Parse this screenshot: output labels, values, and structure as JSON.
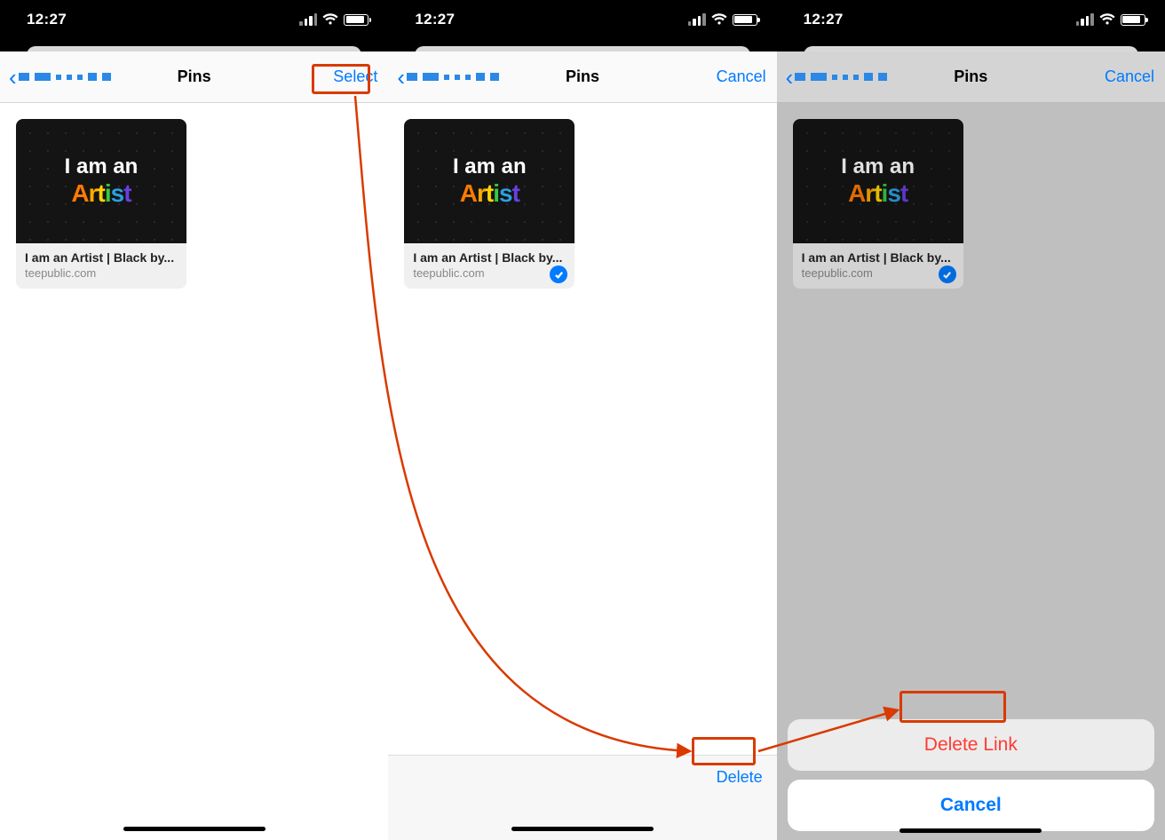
{
  "status": {
    "time": "12:27"
  },
  "nav": {
    "title": "Pins",
    "select": "Select",
    "cancel": "Cancel"
  },
  "card": {
    "line1": "I am an",
    "line2": "Artist",
    "title": "I am an Artist | Black by...",
    "domain": "teepublic.com"
  },
  "toolbar": {
    "delete": "Delete"
  },
  "sheet": {
    "delete_link": "Delete Link",
    "cancel": "Cancel"
  }
}
